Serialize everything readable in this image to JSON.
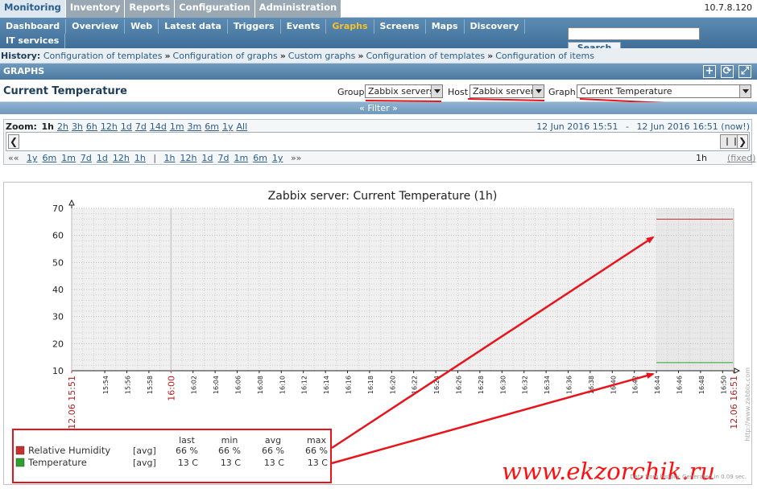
{
  "top_menu": {
    "items": [
      "Monitoring",
      "Inventory",
      "Reports",
      "Configuration",
      "Administration"
    ],
    "active": "Monitoring"
  },
  "server_ip": "10.7.8.120",
  "sub_menu": {
    "items": [
      "Dashboard",
      "Overview",
      "Web",
      "Latest data",
      "Triggers",
      "Events",
      "Graphs",
      "Screens",
      "Maps",
      "Discovery",
      "IT services"
    ],
    "active": "Graphs"
  },
  "search": {
    "button_label": "Search",
    "value": ""
  },
  "history": {
    "label": "History:",
    "items": [
      "Configuration of templates",
      "Configuration of graphs",
      "Custom graphs",
      "Configuration of templates",
      "Configuration of items"
    ]
  },
  "graphs_header": {
    "title": "GRAPHS",
    "buttons": [
      "+",
      "⟳",
      "⤢"
    ]
  },
  "page": {
    "title": "Current Temperature",
    "group_label": "Group",
    "group_value": "Zabbix servers",
    "host_label": "Host",
    "host_value": "Zabbix server",
    "graph_label": "Graph",
    "graph_value": "Current Temperature"
  },
  "filter": {
    "label": "« Filter »"
  },
  "zoom": {
    "label": "Zoom:",
    "items": [
      "1h",
      "2h",
      "3h",
      "6h",
      "12h",
      "1d",
      "7d",
      "14d",
      "1m",
      "3m",
      "6m",
      "1y",
      "All"
    ],
    "current": "1h",
    "date_from": "12 Jun 2016 15:51",
    "date_sep": "-",
    "date_to": "12 Jun 2016 16:51 (now!)"
  },
  "nav": {
    "back_marker": "««",
    "back_items": [
      "1y",
      "6m",
      "1m",
      "7d",
      "1d",
      "12h",
      "1h"
    ],
    "divider": "|",
    "forward_items": [
      "1h",
      "12h",
      "1d",
      "7d",
      "1m",
      "6m",
      "1y"
    ],
    "forward_marker": "»»",
    "period": "1h",
    "fixed_label": "(fixed)"
  },
  "chart_data": {
    "type": "line",
    "title": "Zabbix server: Current Temperature (1h)",
    "ylim": [
      10,
      70
    ],
    "y_ticks": [
      10,
      20,
      30,
      40,
      50,
      60,
      70
    ],
    "x_ticks": [
      "12.06 15:51",
      "15:54",
      "15:56",
      "15:58",
      "16:00",
      "16:02",
      "16:04",
      "16:06",
      "16:08",
      "16:10",
      "16:12",
      "16:14",
      "16:16",
      "16:18",
      "16:20",
      "16:22",
      "16:24",
      "16:26",
      "16:28",
      "16:30",
      "16:32",
      "16:34",
      "16:36",
      "16:38",
      "16:40",
      "16:42",
      "16:44",
      "16:46",
      "16:48",
      "16:50",
      "12.06 16:51"
    ],
    "x_tick_minutes": [
      0,
      3,
      5,
      7,
      9,
      11,
      13,
      15,
      17,
      19,
      21,
      23,
      25,
      27,
      29,
      31,
      33,
      35,
      37,
      39,
      41,
      43,
      45,
      47,
      49,
      51,
      53,
      55,
      57,
      59,
      60
    ],
    "red_ticks": [
      "12.06 15:51",
      "16:00",
      "12.06 16:51"
    ],
    "grid": true,
    "series": [
      {
        "name": "Relative Humidity",
        "func": "[avg]",
        "color": "#c83030",
        "x_start_minute": 53,
        "x_end_minute": 60,
        "value": 66,
        "last": "66 %",
        "min": "66 %",
        "avg": "66 %",
        "max": "66 %"
      },
      {
        "name": "Temperature",
        "func": "[avg]",
        "color": "#2ea02e",
        "x_start_minute": 53,
        "x_end_minute": 60,
        "value": 13,
        "last": "13 C",
        "min": "13 C",
        "avg": "13 C",
        "max": "13 C"
      }
    ],
    "legend_headers": [
      "last",
      "min",
      "avg",
      "max"
    ]
  },
  "watermark": "www.ekzorchik.ru",
  "generated_note": "Data from history. Generated in 0.09 sec.",
  "side_note": "http://www.zabbix.com",
  "annotation_color": "#e8141b"
}
